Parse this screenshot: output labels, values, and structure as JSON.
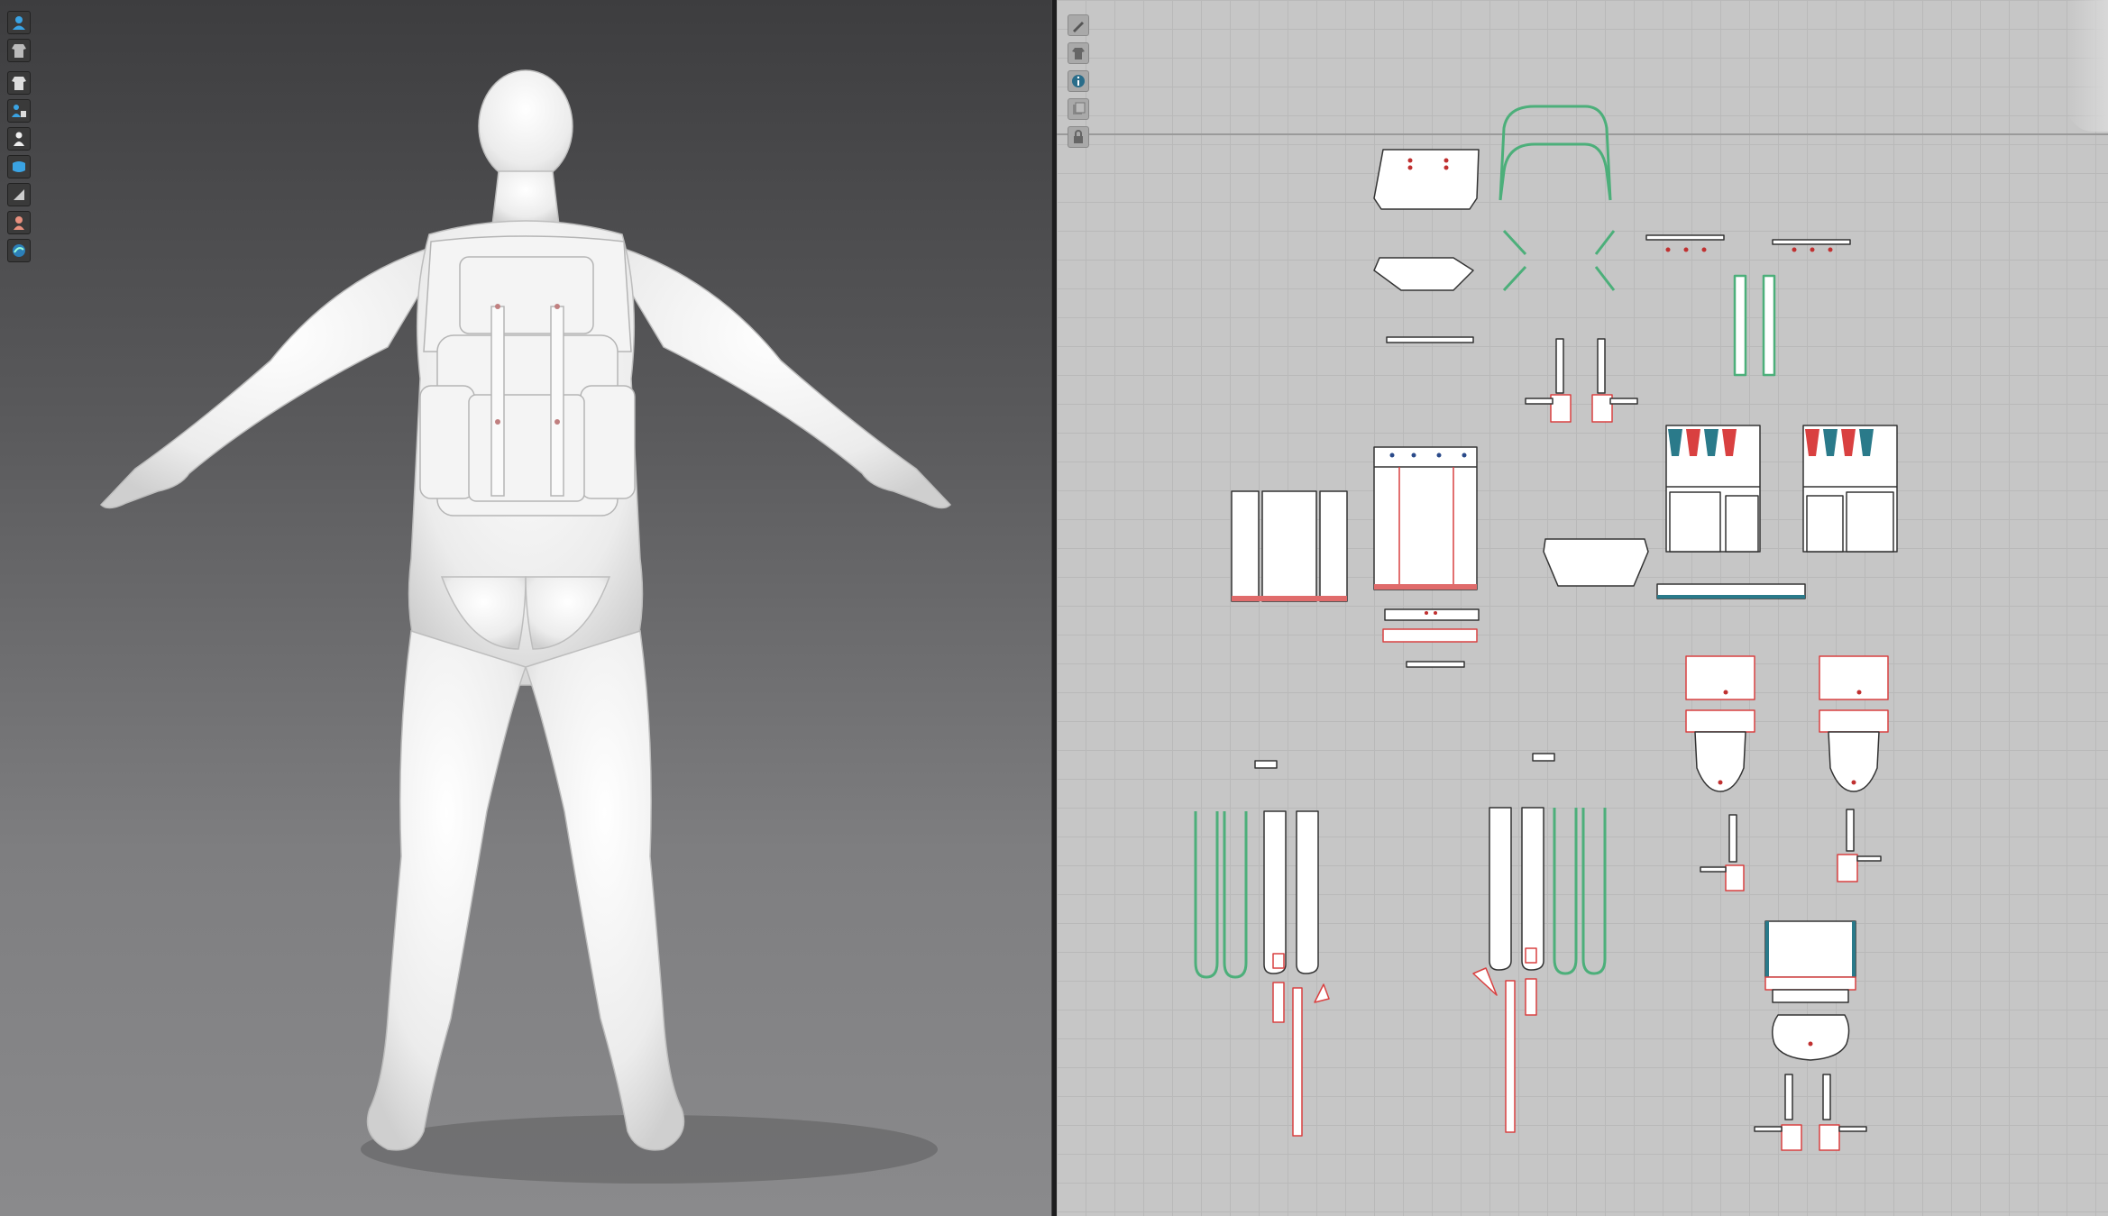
{
  "viewport_3d": {
    "toolbar": [
      {
        "icon": "avatar-icon"
      },
      {
        "icon": "garment-icon"
      },
      {
        "icon": "shirt-icon"
      },
      {
        "icon": "avatar-display-icon"
      },
      {
        "icon": "pose-icon"
      },
      {
        "icon": "fabric-render-icon"
      },
      {
        "icon": "thickness-icon"
      },
      {
        "icon": "skin-icon"
      },
      {
        "icon": "texture-icon"
      }
    ],
    "background_colors": {
      "top": "#3d3d3f",
      "bottom": "#8a8a8c"
    },
    "avatar_color": "#f2f2f2"
  },
  "viewport_2d": {
    "toolbar": [
      {
        "icon": "pencil-icon"
      },
      {
        "icon": "shirt-outline-icon"
      },
      {
        "icon": "info-icon"
      },
      {
        "icon": "pattern-layer-icon"
      },
      {
        "icon": "lock-icon"
      }
    ],
    "grid_color": "#b9b9b9",
    "background_color": "#c6c6c6",
    "seam_colors": {
      "red": "#d94040",
      "teal": "#2a7a8a",
      "green": "#4caf7a",
      "pink": "#e06b6b"
    }
  }
}
